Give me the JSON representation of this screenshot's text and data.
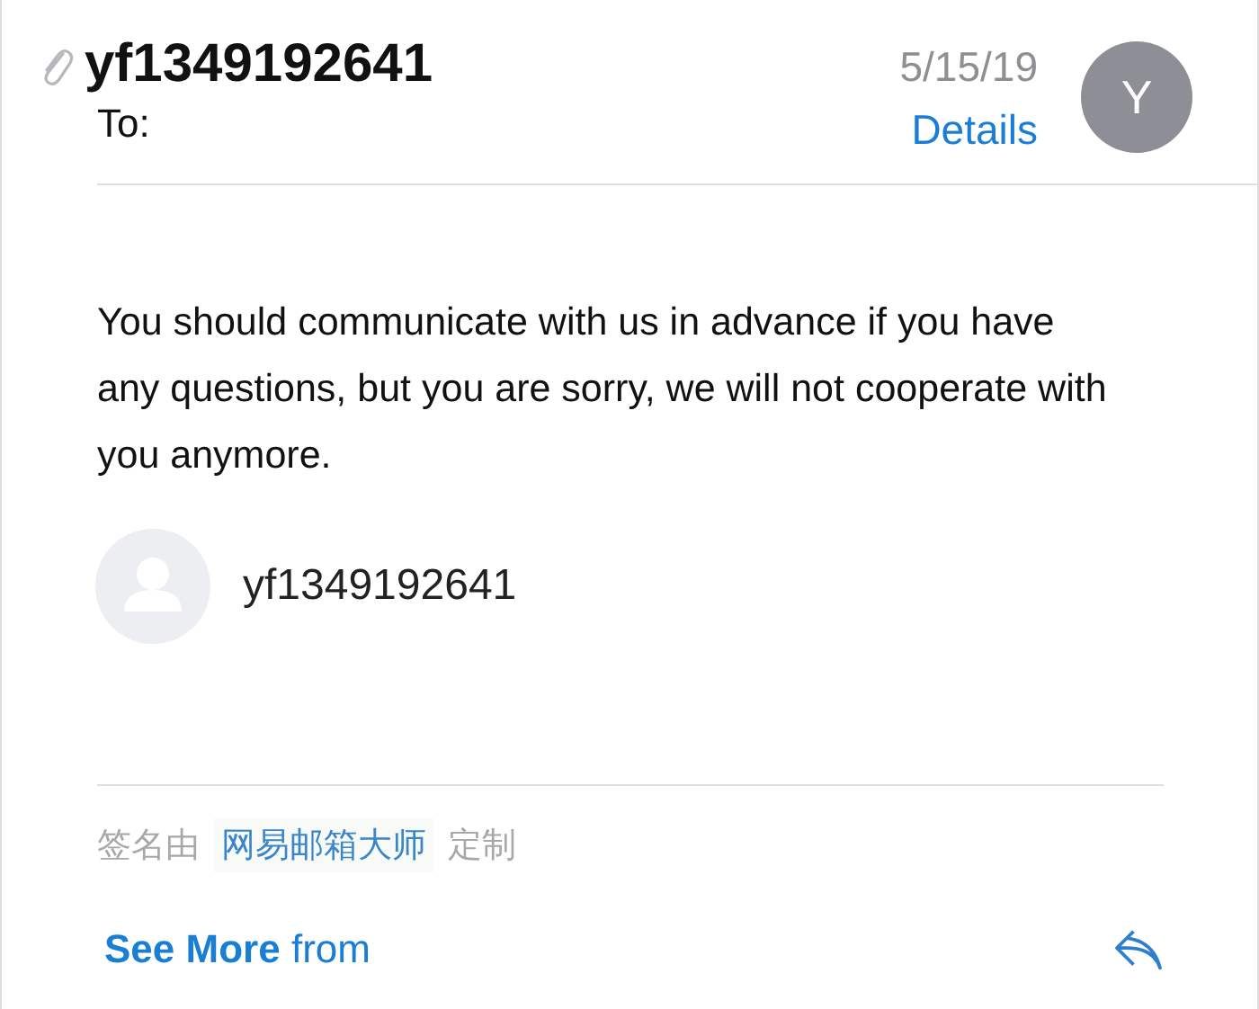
{
  "header": {
    "sender": "yf1349192641",
    "to_label": "To:",
    "date": "5/15/19",
    "details_link": "Details",
    "avatar_initial": "Y",
    "has_attachment": true
  },
  "body": {
    "text": "You should communicate with us in advance if you have any questions, but you are sorry, we will not cooperate with you anymore."
  },
  "signature_card": {
    "name": "yf1349192641"
  },
  "signature_note": {
    "prefix": "签名由",
    "app": "网易邮箱大师",
    "suffix": "定制"
  },
  "footer": {
    "see_more_bold": "See More",
    "see_more_from": "from"
  }
}
